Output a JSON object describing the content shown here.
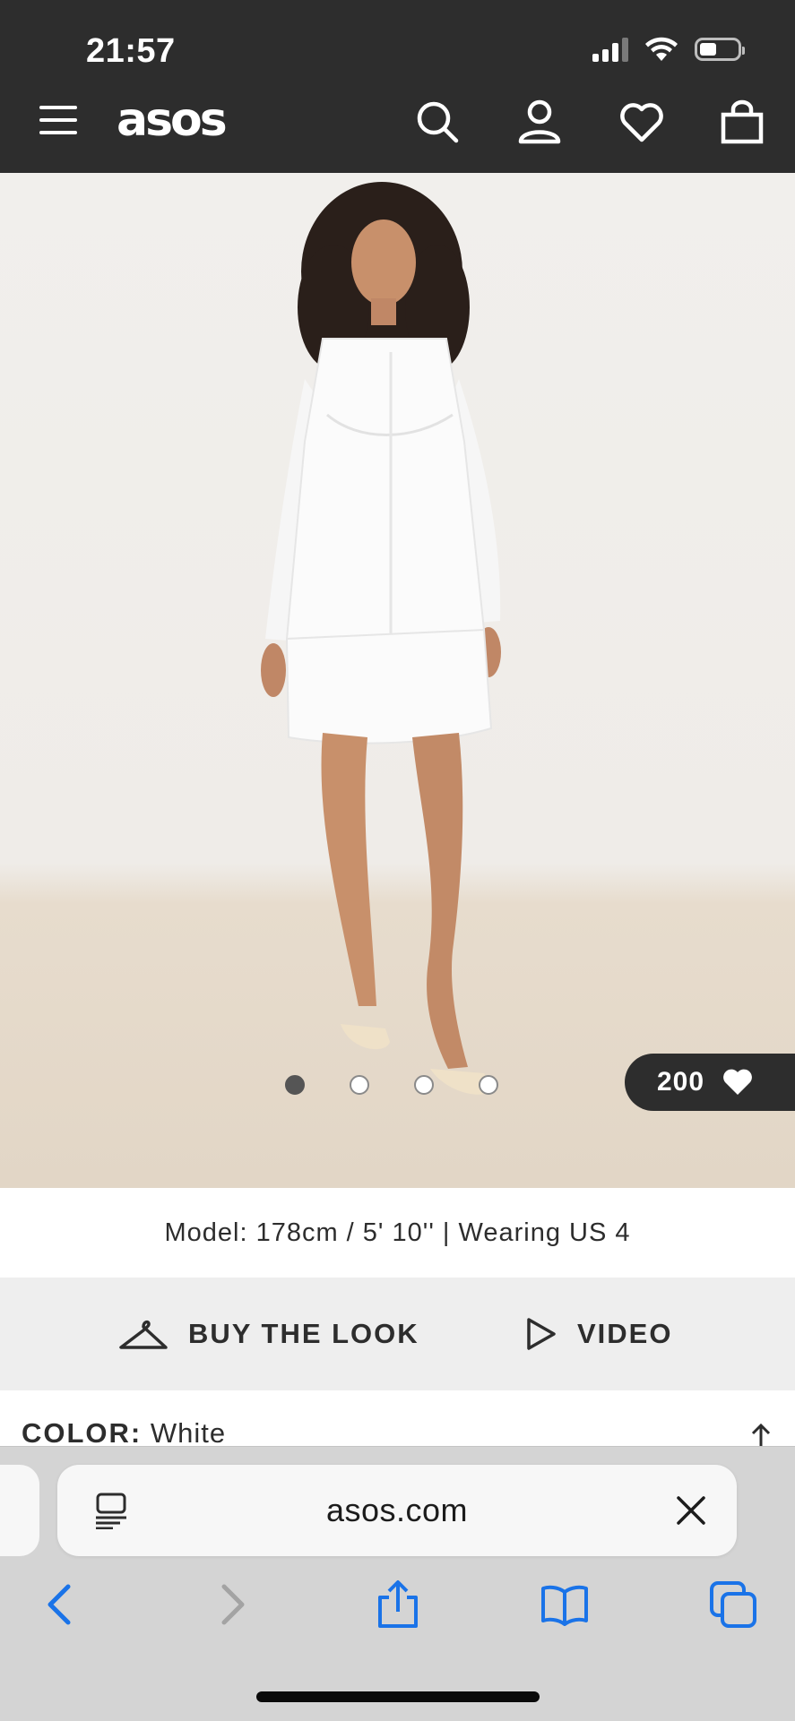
{
  "status_bar": {
    "time": "21:57"
  },
  "header": {
    "logo": "asos",
    "icons": [
      "menu-icon",
      "search-icon",
      "account-icon",
      "heart-icon",
      "bag-icon"
    ]
  },
  "gallery": {
    "image_count": 4,
    "active_index": 0,
    "likes": "200"
  },
  "model_info": "Model: 178cm / 5' 10'' | Wearing US 4",
  "actions": {
    "buy_the_look": "BUY THE LOOK",
    "video": "VIDEO"
  },
  "product": {
    "color_label": "COLOR:",
    "color_value": "White"
  },
  "browser": {
    "url": "asos.com",
    "accent": "#1a73e8",
    "toolbar": [
      "back-icon",
      "forward-icon",
      "share-icon",
      "bookmarks-icon",
      "tabs-icon"
    ]
  },
  "colors": {
    "header_bg": "#2d2d2d",
    "band_bg": "#eeeeee",
    "ios_blue": "#1a73e8"
  }
}
